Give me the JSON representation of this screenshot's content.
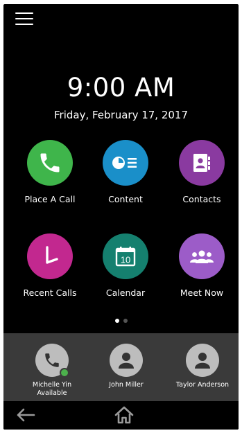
{
  "clock": {
    "time": "9:00 AM",
    "date": "Friday, February 17, 2017"
  },
  "apps": [
    {
      "label": "Place A Call",
      "icon": "phone-icon",
      "color": "#3fb54b"
    },
    {
      "label": "Content",
      "icon": "content-share-icon",
      "color": "#1a8fc9"
    },
    {
      "label": "Contacts",
      "icon": "contact-card-icon",
      "color": "#8a3aa0"
    },
    {
      "label": "Recent Calls",
      "icon": "clock-icon",
      "color": "#c2288f"
    },
    {
      "label": "Calendar",
      "icon": "calendar-icon",
      "color": "#15806f",
      "day": "10"
    },
    {
      "label": "Meet Now",
      "icon": "group-icon",
      "color": "#9c5cc8"
    }
  ],
  "pager": {
    "pages": 2,
    "current": 1
  },
  "favorites": [
    {
      "name": "Michelle Yin",
      "status": "Available",
      "icon": "phone-icon",
      "presence_color": "#4cb04c"
    },
    {
      "name": "John Miller",
      "status": "",
      "icon": "person-icon"
    },
    {
      "name": "Taylor Anderson",
      "status": "",
      "icon": "person-icon"
    }
  ],
  "nav": {
    "back_icon": "back-arrow-icon",
    "home_icon": "home-icon"
  }
}
